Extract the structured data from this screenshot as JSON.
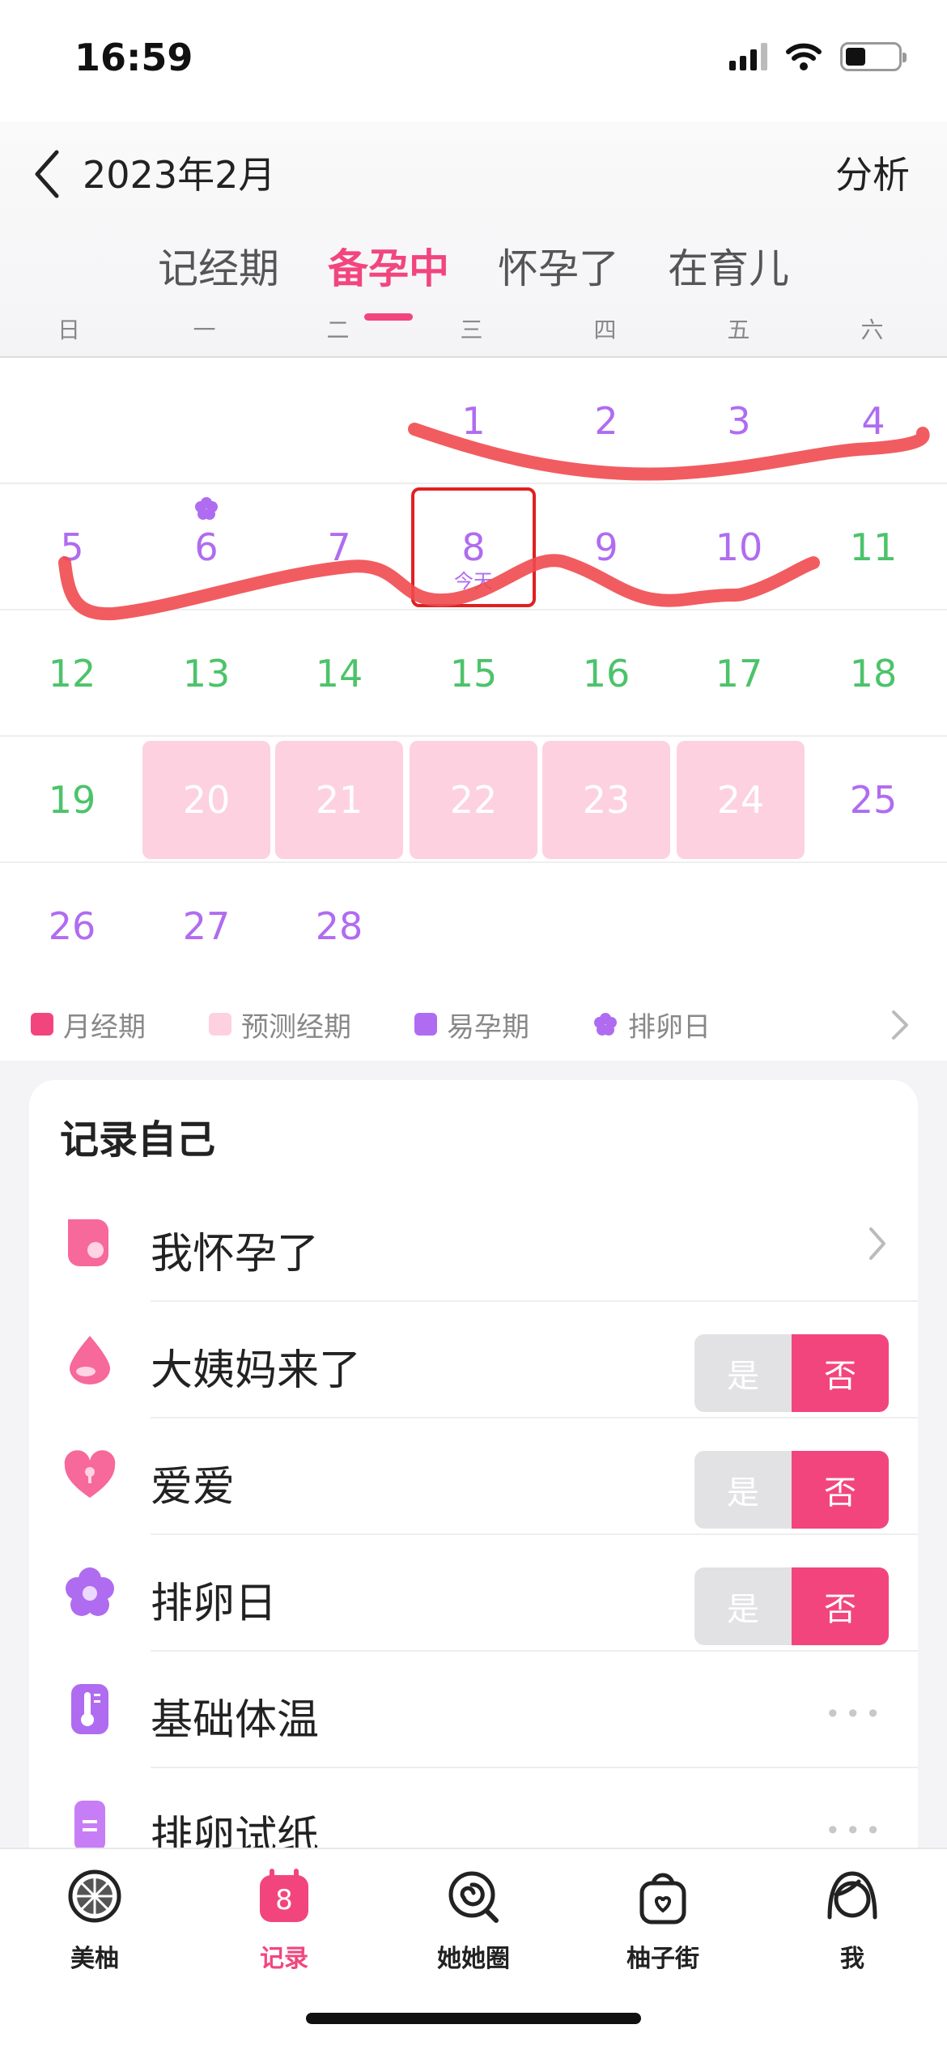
{
  "status": {
    "time": "16:59"
  },
  "header": {
    "month_title": "2023年2月",
    "analyze_label": "分析",
    "tabs": [
      {
        "label": "记经期"
      },
      {
        "label": "备孕中"
      },
      {
        "label": "怀孕了"
      },
      {
        "label": "在育儿"
      }
    ],
    "weekdays": [
      "日",
      "一",
      "二",
      "三",
      "四",
      "五",
      "六"
    ]
  },
  "calendar": {
    "today_label": "今天",
    "rows": [
      [
        "",
        "",
        "",
        "1",
        "2",
        "3",
        "4"
      ],
      [
        "5",
        "6",
        "7",
        "8",
        "9",
        "10",
        "11"
      ],
      [
        "12",
        "13",
        "14",
        "15",
        "16",
        "17",
        "18"
      ],
      [
        "19",
        "20",
        "21",
        "22",
        "23",
        "24",
        "25"
      ],
      [
        "26",
        "27",
        "28",
        "",
        "",
        "",
        ""
      ]
    ]
  },
  "legend": [
    {
      "label": "月经期",
      "color": "#f2457e"
    },
    {
      "label": "预测经期",
      "color": "#fdd1e0"
    },
    {
      "label": "易孕期",
      "color": "#b06cf0"
    },
    {
      "label": "排卵日",
      "color": "#b06cf0"
    }
  ],
  "record": {
    "title": "记录自己",
    "items": [
      {
        "label": "我怀孕了",
        "control": "chevron"
      },
      {
        "label": "大姨妈来了",
        "control": "toggle",
        "yes": "是",
        "no": "否"
      },
      {
        "label": "爱爱",
        "control": "toggle",
        "yes": "是",
        "no": "否"
      },
      {
        "label": "排卵日",
        "control": "toggle",
        "yes": "是",
        "no": "否"
      },
      {
        "label": "基础体温",
        "control": "more"
      },
      {
        "label": "排卵试纸",
        "control": "more"
      }
    ]
  },
  "tabbar": {
    "record_badge": "8",
    "items": [
      {
        "label": "美柚"
      },
      {
        "label": "记录"
      },
      {
        "label": "她她圈"
      },
      {
        "label": "柚子街"
      },
      {
        "label": "我"
      }
    ]
  },
  "colors": {
    "accent": "#f2457e",
    "purple": "#b06cf0",
    "green": "#4cc36a",
    "predict": "#fdd1e0"
  }
}
